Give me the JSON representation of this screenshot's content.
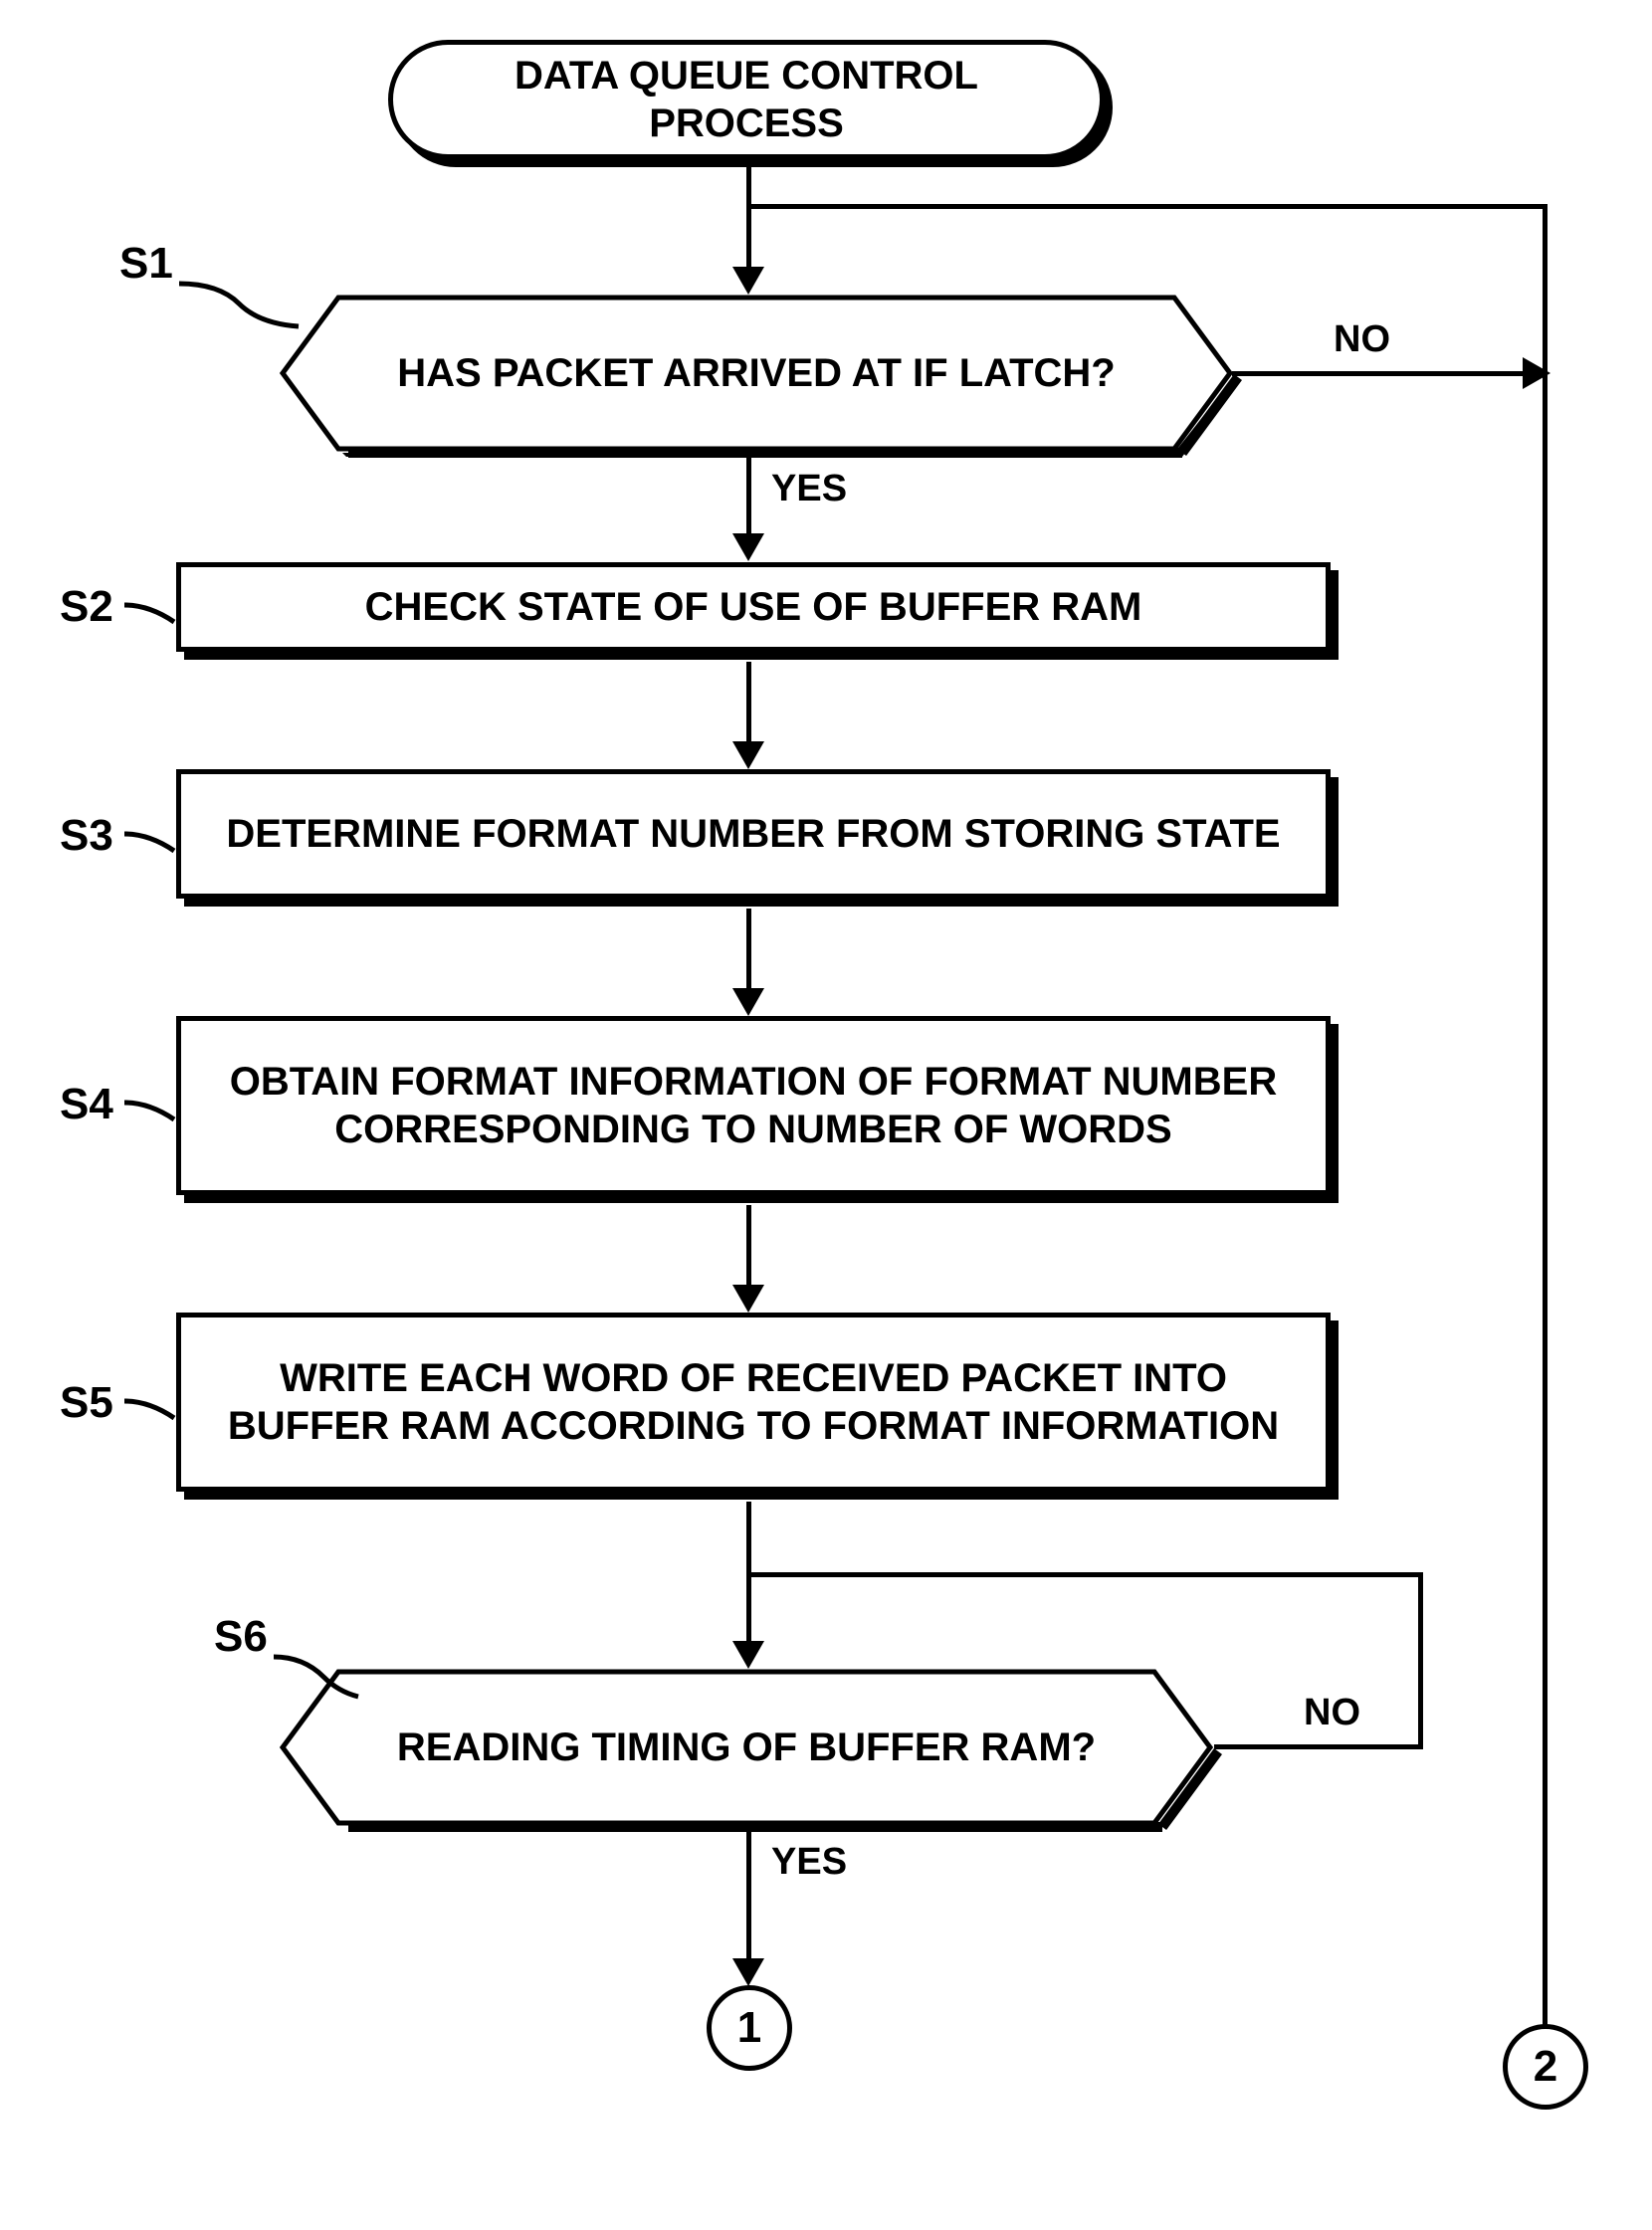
{
  "title": "DATA QUEUE CONTROL PROCESS",
  "steps": {
    "s1": {
      "label": "S1",
      "text": "HAS PACKET ARRIVED AT IF LATCH?"
    },
    "s2": {
      "label": "S2",
      "text": "CHECK STATE OF USE OF BUFFER RAM"
    },
    "s3": {
      "label": "S3",
      "text": "DETERMINE FORMAT NUMBER FROM STORING STATE"
    },
    "s4": {
      "label": "S4",
      "text": "OBTAIN FORMAT INFORMATION OF FORMAT NUMBER CORRESPONDING TO NUMBER OF WORDS"
    },
    "s5": {
      "label": "S5",
      "text": "WRITE EACH WORD OF RECEIVED PACKET INTO BUFFER RAM ACCORDING TO FORMAT INFORMATION"
    },
    "s6": {
      "label": "S6",
      "text": "READING TIMING OF BUFFER RAM?"
    }
  },
  "branches": {
    "yes": "YES",
    "no": "NO"
  },
  "connectors": {
    "c1": "1",
    "c2": "2"
  }
}
